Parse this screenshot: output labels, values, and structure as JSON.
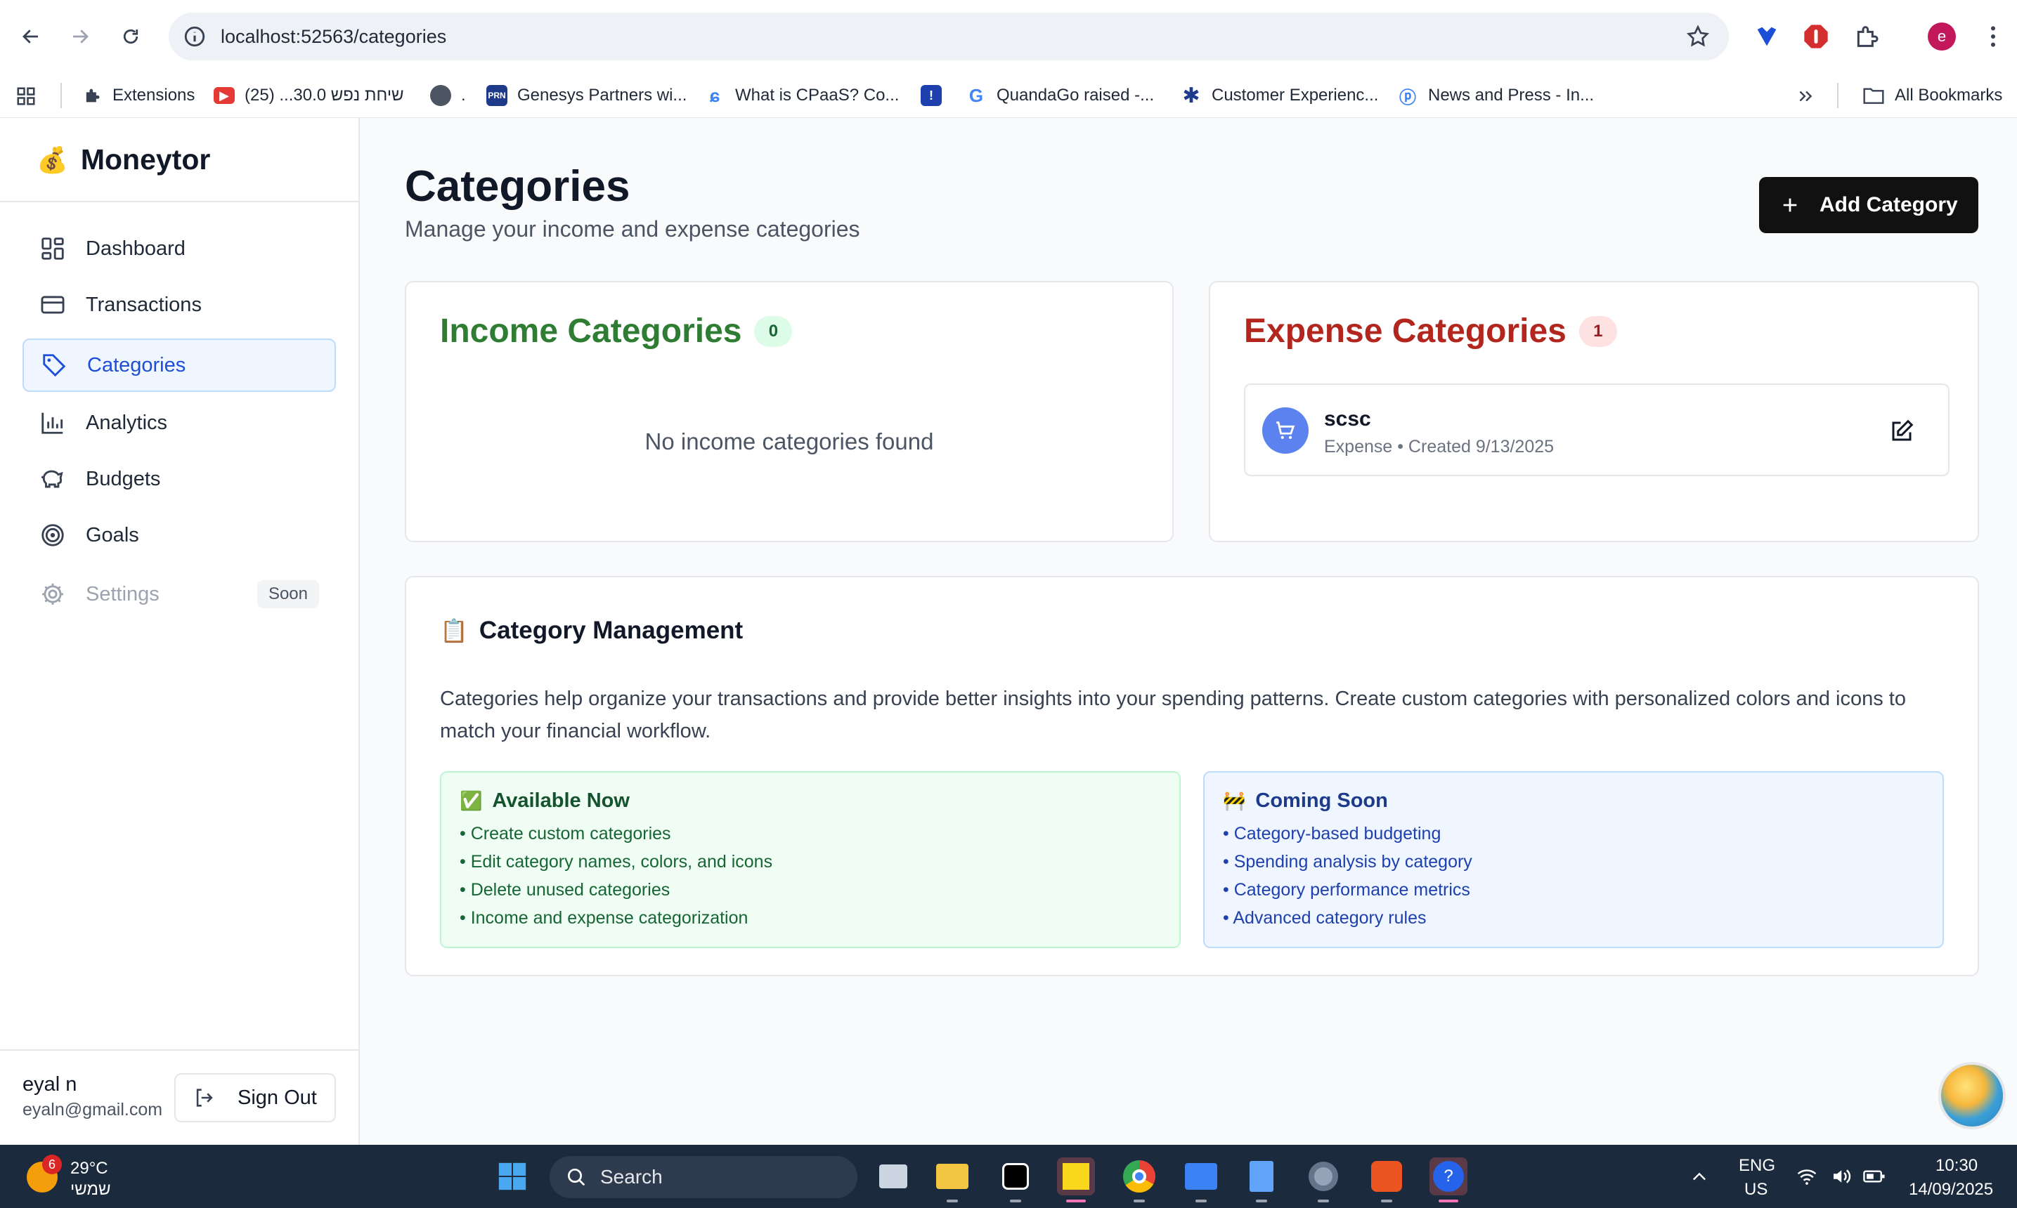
{
  "browser": {
    "url": "localhost:52563/categories",
    "profile_initial": "e",
    "bookmarks": [
      {
        "label": "Extensions",
        "icon": "puzzle-icon"
      },
      {
        "label": "שיחת נפש 30.0... (25)",
        "icon": "youtube-icon"
      },
      {
        "label": ".",
        "icon": "globe-icon"
      },
      {
        "label": "Genesys Partners wi...",
        "icon": "prn-icon"
      },
      {
        "label": "What is CPaaS? Co...",
        "icon": "swirl-icon"
      },
      {
        "label": "",
        "icon": "exclaim-icon"
      },
      {
        "label": "QuandaGo raised -...",
        "icon": "google-icon"
      },
      {
        "label": "Customer Experienc...",
        "icon": "star-cluster-icon"
      },
      {
        "label": "News and Press - In...",
        "icon": "speech-icon"
      }
    ],
    "all_bookmarks": "All Bookmarks"
  },
  "sidebar": {
    "brand_emoji": "💰",
    "brand": "Moneytor",
    "items": [
      {
        "label": "Dashboard",
        "icon": "dashboard-icon"
      },
      {
        "label": "Transactions",
        "icon": "card-icon"
      },
      {
        "label": "Categories",
        "icon": "tag-icon"
      },
      {
        "label": "Analytics",
        "icon": "bar-chart-icon"
      },
      {
        "label": "Budgets",
        "icon": "piggy-bank-icon"
      },
      {
        "label": "Goals",
        "icon": "target-icon"
      },
      {
        "label": "Settings",
        "icon": "gear-icon",
        "badge": "Soon"
      }
    ],
    "user": {
      "name": "eyal n",
      "email": "eyaln@gmail.com"
    },
    "sign_out": "Sign Out"
  },
  "main": {
    "title": "Categories",
    "subtitle": "Manage your income and expense categories",
    "add_button": "Add Category",
    "income": {
      "title": "Income Categories",
      "count": "0",
      "empty": "No income categories found",
      "color": "#2f7d32"
    },
    "expense": {
      "title": "Expense Categories",
      "count": "1",
      "color": "#b3261e",
      "items": [
        {
          "name": "scsc",
          "meta": "Expense • Created 9/13/2025",
          "icon": "cart-icon"
        }
      ]
    },
    "management": {
      "emoji": "📋",
      "title": "Category Management",
      "description": "Categories help organize your transactions and provide better insights into your spending patterns. Create custom categories with personalized colors and icons to match your financial workflow.",
      "available": {
        "emoji": "✅",
        "title": "Available Now",
        "items": [
          "• Create custom categories",
          "• Edit category names, colors, and icons",
          "• Delete unused categories",
          "• Income and expense categorization"
        ]
      },
      "soon": {
        "emoji": "🚧",
        "title": "Coming Soon",
        "items": [
          "• Category-based budgeting",
          "• Spending analysis by category",
          "• Category performance metrics",
          "• Advanced category rules"
        ]
      }
    }
  },
  "taskbar": {
    "weather_badge": "6",
    "temperature": "29°C",
    "weather_desc": "שמשי",
    "search": "Search",
    "lang_top": "ENG",
    "lang_bottom": "US",
    "time": "10:30",
    "date": "14/09/2025"
  }
}
